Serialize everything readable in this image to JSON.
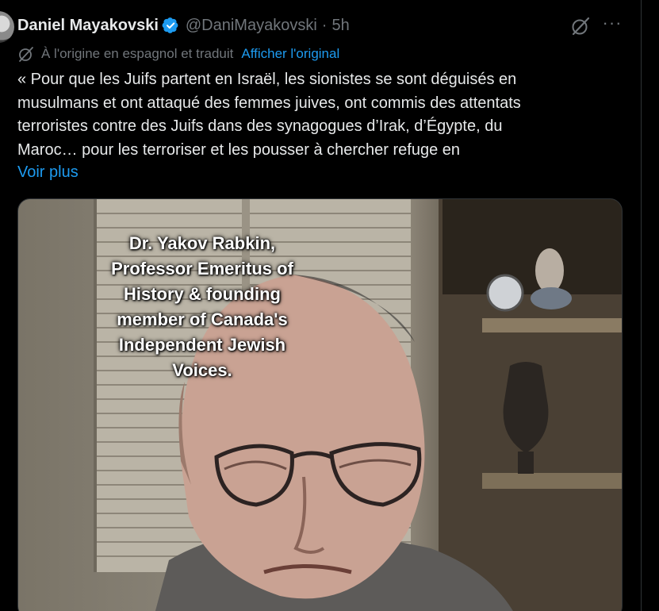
{
  "post": {
    "author_name": "Daniel Mayakovski",
    "handle": "@DaniMayakovski",
    "separator": "·",
    "time": "5h",
    "more": "···",
    "translation_note": "À l'origine en espagnol et traduit",
    "show_original": "Afficher l'original",
    "text_lines": [
      "« Pour que les Juifs partent en Israël, les sionistes se sont déguisés en",
      "musulmans et ont attaqué des femmes juives, ont commis des attentats",
      "terroristes contre des Juifs dans des synagogues d’Irak, d’Égypte, du",
      "Maroc… pour les terroriser et les pousser à chercher refuge en"
    ],
    "see_more": "Voir plus"
  },
  "media": {
    "caption_lines": [
      "Dr. Yakov Rabkin,",
      "Professor Emeritus of",
      "History & founding",
      "member of Canada's",
      "Independent Jewish",
      "Voices."
    ]
  },
  "icons": {
    "verified": "verified-badge-icon",
    "grok": "grok-icon",
    "translate": "translate-icon",
    "more": "more-icon"
  },
  "colors": {
    "background": "#000000",
    "text": "#e7e9ea",
    "muted": "#71767b",
    "link": "#1d9bf0"
  }
}
